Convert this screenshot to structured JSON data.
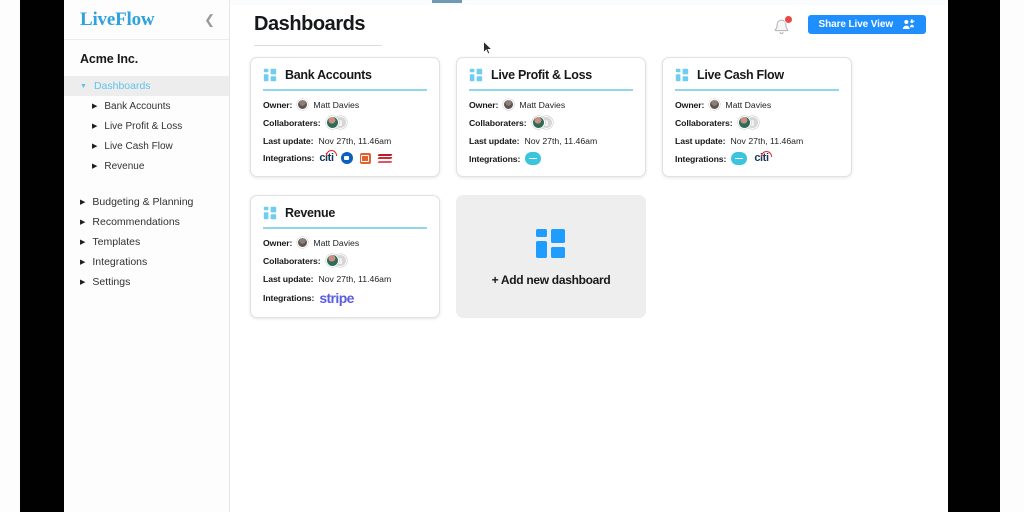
{
  "app": {
    "brand": "LiveFlow",
    "collapse_icon": "chevron-left-icon"
  },
  "sidebar": {
    "company": "Acme Inc.",
    "items": [
      {
        "label": "Dashboards",
        "active": true,
        "marker": "▼"
      },
      {
        "label": "Bank Accounts",
        "sub": true,
        "marker": "▶"
      },
      {
        "label": "Live Profit & Loss",
        "sub": true,
        "marker": "▶"
      },
      {
        "label": "Live Cash Flow",
        "sub": true,
        "marker": "▶"
      },
      {
        "label": "Revenue",
        "sub": true,
        "marker": "▶"
      }
    ],
    "items2": [
      {
        "label": "Budgeting & Planning",
        "marker": "▶"
      },
      {
        "label": "Recommendations",
        "marker": "▶"
      },
      {
        "label": "Templates",
        "marker": "▶"
      },
      {
        "label": "Integrations",
        "marker": "▶"
      },
      {
        "label": "Settings",
        "marker": "▶"
      }
    ]
  },
  "header": {
    "title": "Dashboards",
    "notification_icon": "bell-icon",
    "notification_badge": "",
    "share_label": "Share Live View",
    "share_icon": "people-add-icon",
    "cursor_icon": "mouse-pointer-icon"
  },
  "cards": [
    {
      "title": "Bank Accounts",
      "icon": "dashboard-grid-icon",
      "owner_label": "Owner:",
      "owner": "Matt Davies",
      "collaborators_label": "Collaboraters:",
      "last_update_label": "Last update:",
      "last_update": "Nov 27th, 11.46am",
      "integrations_label": "Integrations:",
      "integrations": [
        "citi",
        "chase",
        "capital-one",
        "bank-of-america"
      ]
    },
    {
      "title": "Live Profit & Loss",
      "icon": "dashboard-grid-icon",
      "owner_label": "Owner:",
      "owner": "Matt Davies",
      "collaborators_label": "Collaboraters:",
      "last_update_label": "Last update:",
      "last_update": "Nov 27th, 11.46am",
      "integrations_label": "Integrations:",
      "integrations": [
        "quickbooks"
      ]
    },
    {
      "title": "Live Cash Flow",
      "icon": "dashboard-grid-icon",
      "owner_label": "Owner:",
      "owner": "Matt Davies",
      "collaborators_label": "Collaboraters:",
      "last_update_label": "Last update:",
      "last_update": "Nov 27th, 11.46am",
      "integrations_label": "Integrations:",
      "integrations": [
        "quickbooks",
        "citi"
      ]
    },
    {
      "title": "Revenue",
      "icon": "dashboard-grid-icon",
      "owner_label": "Owner:",
      "owner": "Matt Davies",
      "collaborators_label": "Collaboraters:",
      "last_update_label": "Last update:",
      "last_update": "Nov 27th, 11.46am",
      "integrations_label": "Integrations:",
      "integrations": [
        "stripe"
      ]
    }
  ],
  "add_card": {
    "label": "+ Add new dashboard",
    "icon": "dashboard-grid-icon"
  },
  "float_logo": {
    "icon": "liveflow-logo-icon"
  },
  "colors": {
    "brand_blue": "#2ea2dd",
    "accent_cyan": "#5ec3ec",
    "share_button": "#1f8fff",
    "badge_red": "#eb4747",
    "add_icon_blue": "#1f9dff",
    "stripe_purple": "#5b5ce2"
  },
  "integration_labels": {
    "citi": "citi",
    "stripe": "stripe"
  }
}
